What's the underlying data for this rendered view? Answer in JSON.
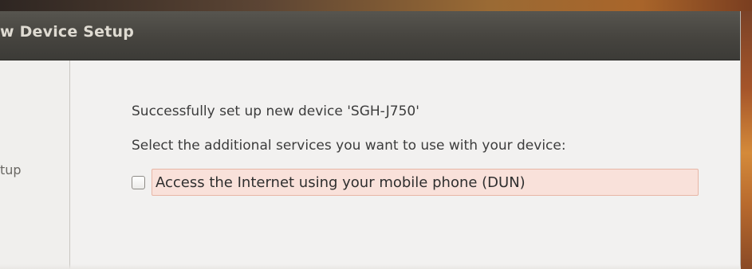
{
  "window": {
    "title": "w Device Setup"
  },
  "sidebar": {
    "items": [
      {
        "label": "tup"
      }
    ]
  },
  "main": {
    "status_text": "Successfully set up new device 'SGH-J750'",
    "instruction_text": "Select the additional services you want to use with your device:",
    "services": [
      {
        "label": "Access the Internet using your mobile phone (DUN)",
        "checked": false
      }
    ]
  },
  "colors": {
    "titlebar": "#3c3b37",
    "title_text": "#dfdbd2",
    "window_bg": "#f2f1f0",
    "highlight_bg": "#f9e1da",
    "highlight_border": "#e7b6a6"
  }
}
